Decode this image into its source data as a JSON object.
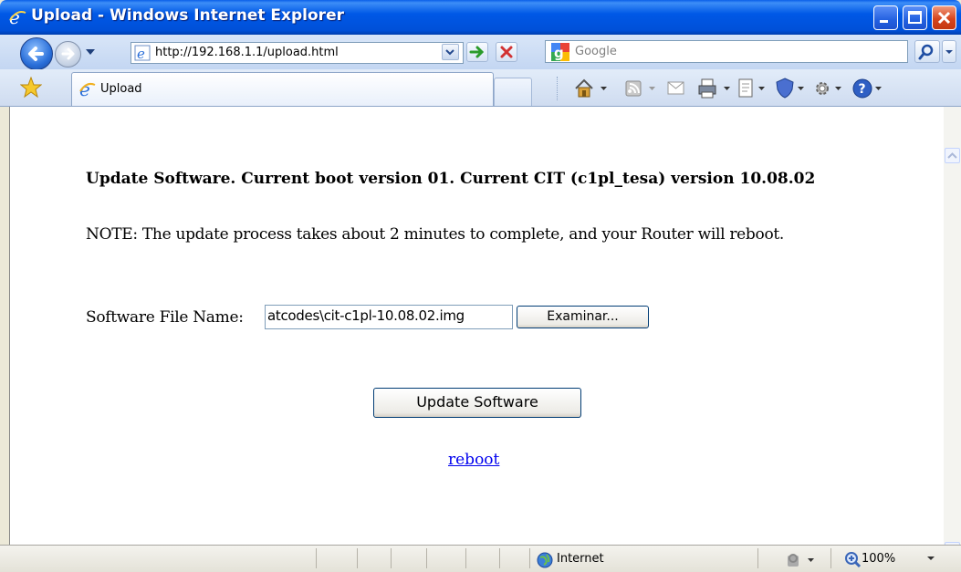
{
  "window": {
    "title": "Upload - Windows Internet Explorer"
  },
  "navigation": {
    "address": "http://192.168.1.1/upload.html",
    "search_placeholder": "Google"
  },
  "tabs": [
    {
      "label": "Upload",
      "active": true
    }
  ],
  "page": {
    "heading": "Update Software. Current boot version 01. Current CIT (c1pl_tesa) version 10.08.02",
    "note": "NOTE: The update process takes about 2 minutes to complete, and your Router will reboot.",
    "file_label": "Software File Name:",
    "file_value": "atcodes\\cit-c1pl-10.08.02.img",
    "browse_label": "Examinar...",
    "update_label": "Update Software",
    "reboot_label": "reboot"
  },
  "status": {
    "zone": "Internet",
    "zoom": "100%"
  },
  "colors": {
    "titlebar": "#0058e6",
    "link": "#0000ee"
  }
}
